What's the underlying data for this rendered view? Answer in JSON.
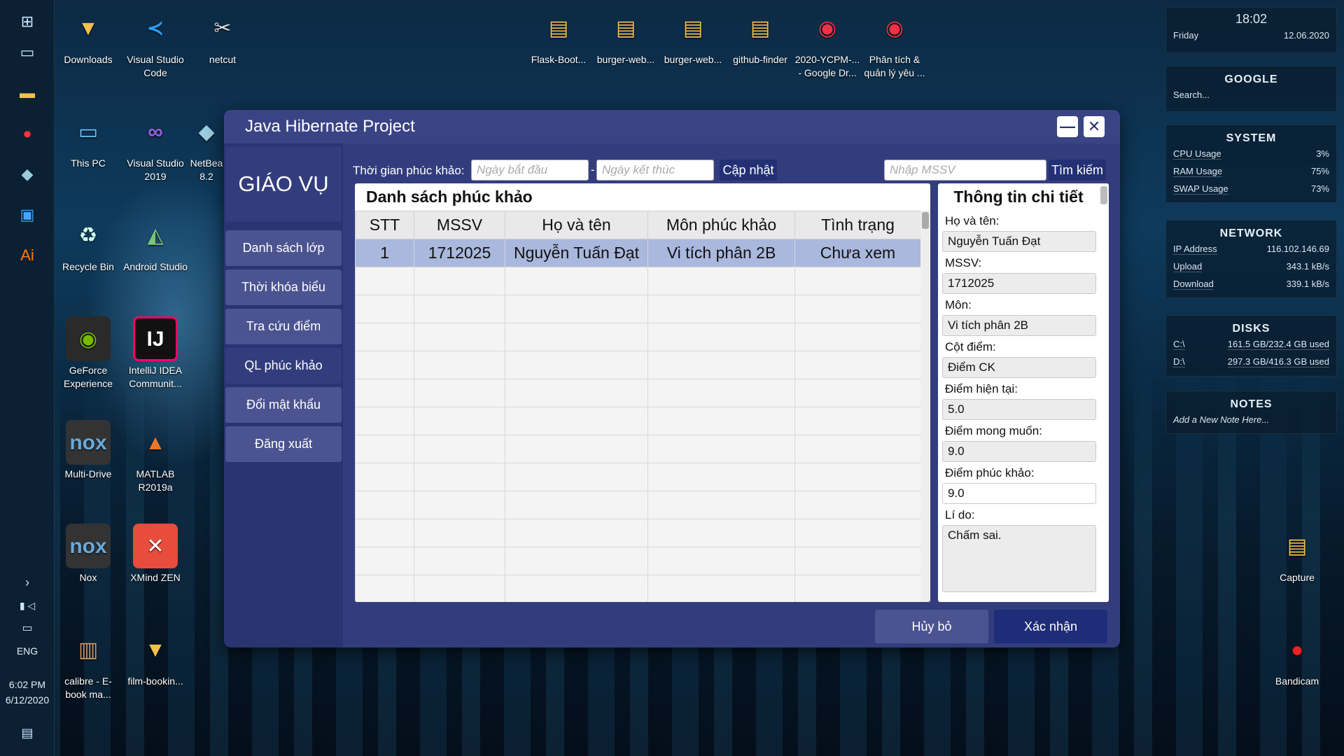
{
  "taskbar": {
    "lang": "ENG",
    "time": "6:02 PM",
    "date": "6/12/2020"
  },
  "desktop_icons": {
    "col1": [
      "Downloads",
      "This PC",
      "Recycle Bin",
      "GeForce Experience",
      "Multi-Drive",
      "Nox",
      "calibre - E-book ma..."
    ],
    "col2": [
      "Visual Studio Code",
      "Visual Studio 2019",
      "Android Studio",
      "IntelliJ IDEA Communit...",
      "MATLAB R2019a",
      "XMind ZEN",
      "film-bookin..."
    ],
    "col3": [
      "netcut",
      "NetBea 8.2"
    ],
    "top": [
      "Flask-Boot...",
      "burger-web...",
      "burger-web...",
      "github-finder",
      "2020-YCPM-... - Google Dr...",
      "Phân tích & quản lý yêu ..."
    ],
    "right": [
      "Capture",
      "Bandicam"
    ]
  },
  "widgets": {
    "clock": {
      "time": "18:02",
      "day": "Friday",
      "date": "12.06.2020"
    },
    "google": {
      "title": "GOOGLE",
      "placeholder": "Search..."
    },
    "system": {
      "title": "SYSTEM",
      "rows": [
        [
          "CPU Usage",
          "3%"
        ],
        [
          "RAM Usage",
          "75%"
        ],
        [
          "SWAP Usage",
          "73%"
        ]
      ]
    },
    "network": {
      "title": "NETWORK",
      "rows": [
        [
          "IP Address",
          "116.102.146.69"
        ],
        [
          "Upload",
          "343.1 kB/s"
        ],
        [
          "Download",
          "339.1 kB/s"
        ]
      ]
    },
    "disks": {
      "title": "DISKS",
      "rows": [
        [
          "C:\\",
          "161.5 GB/232.4 GB used"
        ],
        [
          "D:\\",
          "297.3 GB/416.3 GB used"
        ]
      ]
    },
    "notes": {
      "title": "NOTES",
      "hint": "Add a New Note Here..."
    }
  },
  "window": {
    "title": "Java Hibernate Project",
    "minimize": "—",
    "close": "✕"
  },
  "sidebar": {
    "brand": "GIÁO VỤ",
    "items": [
      "Danh sách lớp",
      "Thời khóa biểu",
      "Tra cứu điểm",
      "QL phúc khảo",
      "Đổi mật khẩu",
      "Đăng xuất"
    ]
  },
  "filter": {
    "label": "Thời gian phúc khảo:",
    "start_placeholder": "Ngày bắt đầu",
    "dash": "-",
    "end_placeholder": "Ngày kết thúc",
    "update": "Cập nhật",
    "mssv_placeholder": "Nhập MSSV",
    "search": "Tìm kiếm"
  },
  "list": {
    "title": "Danh sách phúc khảo",
    "columns": [
      "STT",
      "MSSV",
      "Họ và tên",
      "Môn phúc khảo",
      "Tình trạng"
    ],
    "rows": [
      [
        "1",
        "1712025",
        "Nguyễn Tuấn Đạt",
        "Vi tích phân 2B",
        "Chưa xem"
      ]
    ]
  },
  "detail": {
    "title": "Thông tin chi tiết",
    "fields": [
      {
        "label": "Họ và tên:",
        "value": "Nguyễn Tuấn Đạt"
      },
      {
        "label": "MSSV:",
        "value": "1712025"
      },
      {
        "label": "Môn:",
        "value": "Vi tích phân 2B"
      },
      {
        "label": "Cột điểm:",
        "value": "Điểm CK"
      },
      {
        "label": "Điểm hiện tại:",
        "value": "5.0"
      },
      {
        "label": "Điểm mong muốn:",
        "value": "9.0"
      },
      {
        "label": "Điểm phúc khảo:",
        "value": "9.0"
      }
    ],
    "reason_label": "Lí do:",
    "reason_value": "Chấm sai."
  },
  "actions": {
    "cancel": "Hủy bỏ",
    "confirm": "Xác nhận"
  }
}
